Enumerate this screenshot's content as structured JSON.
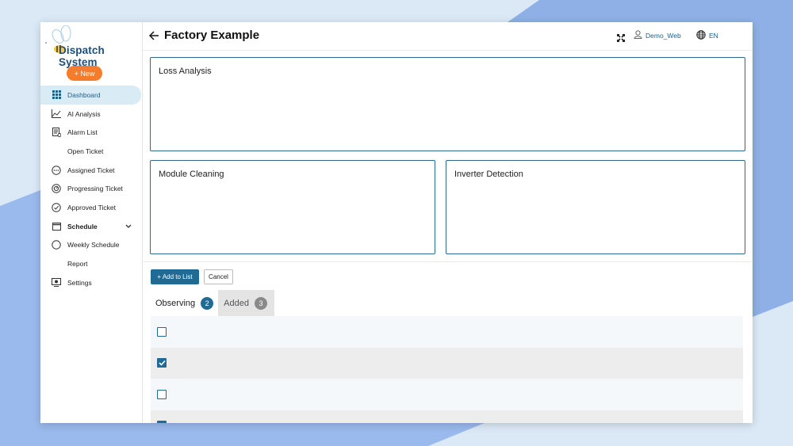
{
  "colors": {
    "accent": "#1f6b95",
    "new_button": "#f47c2c",
    "active_nav_bg": "#d9ebf5",
    "background_shape": "#8fb4ea"
  },
  "sidebar": {
    "logo_text": "Dispatch System",
    "new_button": "+ New",
    "items": [
      {
        "label": "Dashboard",
        "icon": "grid-icon",
        "active": true
      },
      {
        "label": "AI Analysis",
        "icon": "line-chart-icon"
      },
      {
        "label": "Alarm List",
        "icon": "list-doc-icon"
      },
      {
        "label": "Open Ticket",
        "icon": ""
      },
      {
        "label": "Assigned Ticket",
        "icon": "ellipsis-circle-icon"
      },
      {
        "label": "Progressing Ticket",
        "icon": "progress-circle-icon"
      },
      {
        "label": "Approved Ticket",
        "icon": "check-circle-icon"
      },
      {
        "label": "Schedule",
        "icon": "calendar-icon",
        "expandable": true
      },
      {
        "label": "Weekly Schedule",
        "icon": "circle-icon"
      },
      {
        "label": "Report",
        "icon": ""
      },
      {
        "label": "Settings",
        "icon": "settings-monitor-icon"
      }
    ]
  },
  "header": {
    "title": "Factory Example",
    "user": "Demo_Web",
    "language": "EN"
  },
  "panels": {
    "loss_analysis": "Loss Analysis",
    "module_cleaning": "Module Cleaning",
    "inverter_detection": "Inverter Detection"
  },
  "actions": {
    "add_to_list": "+ Add to List",
    "cancel": "Cancel"
  },
  "tabs": [
    {
      "label": "Observing",
      "count": "2",
      "active": true
    },
    {
      "label": "Added",
      "count": "3",
      "active": false
    }
  ],
  "rows": [
    {
      "checked": false
    },
    {
      "checked": true
    },
    {
      "checked": false
    },
    {
      "checked": true
    }
  ]
}
